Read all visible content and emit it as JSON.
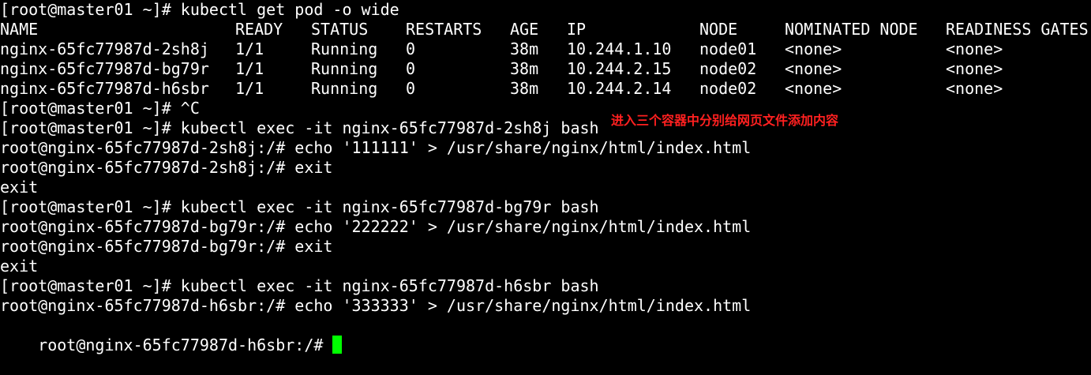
{
  "terminal": {
    "colors": {
      "background": "#000000",
      "foreground": "#ffffff",
      "cursor": "#00ff00",
      "annotation": "#ff2020"
    },
    "get_pod_command": "[root@master01 ~]# kubectl get pod -o wide",
    "table": {
      "headers": [
        "NAME",
        "READY",
        "STATUS",
        "RESTARTS",
        "AGE",
        "IP",
        "NODE",
        "NOMINATED NODE",
        "READINESS GATES"
      ],
      "rows": [
        [
          "nginx-65fc77987d-2sh8j",
          "1/1",
          "Running",
          "0",
          "38m",
          "10.244.1.10",
          "node01",
          "<none>",
          "<none>"
        ],
        [
          "nginx-65fc77987d-bg79r",
          "1/1",
          "Running",
          "0",
          "38m",
          "10.244.2.15",
          "node02",
          "<none>",
          "<none>"
        ],
        [
          "nginx-65fc77987d-h6sbr",
          "1/1",
          "Running",
          "0",
          "38m",
          "10.244.2.14",
          "node02",
          "<none>",
          "<none>"
        ]
      ]
    },
    "lines_after_table": [
      "[root@master01 ~]# ^C",
      "[root@master01 ~]# kubectl exec -it nginx-65fc77987d-2sh8j bash",
      "root@nginx-65fc77987d-2sh8j:/# echo '111111' > /usr/share/nginx/html/index.html",
      "root@nginx-65fc77987d-2sh8j:/# exit",
      "exit",
      "[root@master01 ~]# kubectl exec -it nginx-65fc77987d-bg79r bash",
      "root@nginx-65fc77987d-bg79r:/# echo '222222' > /usr/share/nginx/html/index.html",
      "root@nginx-65fc77987d-bg79r:/# exit",
      "exit",
      "[root@master01 ~]# kubectl exec -it nginx-65fc77987d-h6sbr bash",
      "root@nginx-65fc77987d-h6sbr:/# echo '333333' > /usr/share/nginx/html/index.html"
    ],
    "current_prompt": "root@nginx-65fc77987d-h6sbr:/# ",
    "annotation": "进入三个容器中分别给网页文件添加内容"
  }
}
